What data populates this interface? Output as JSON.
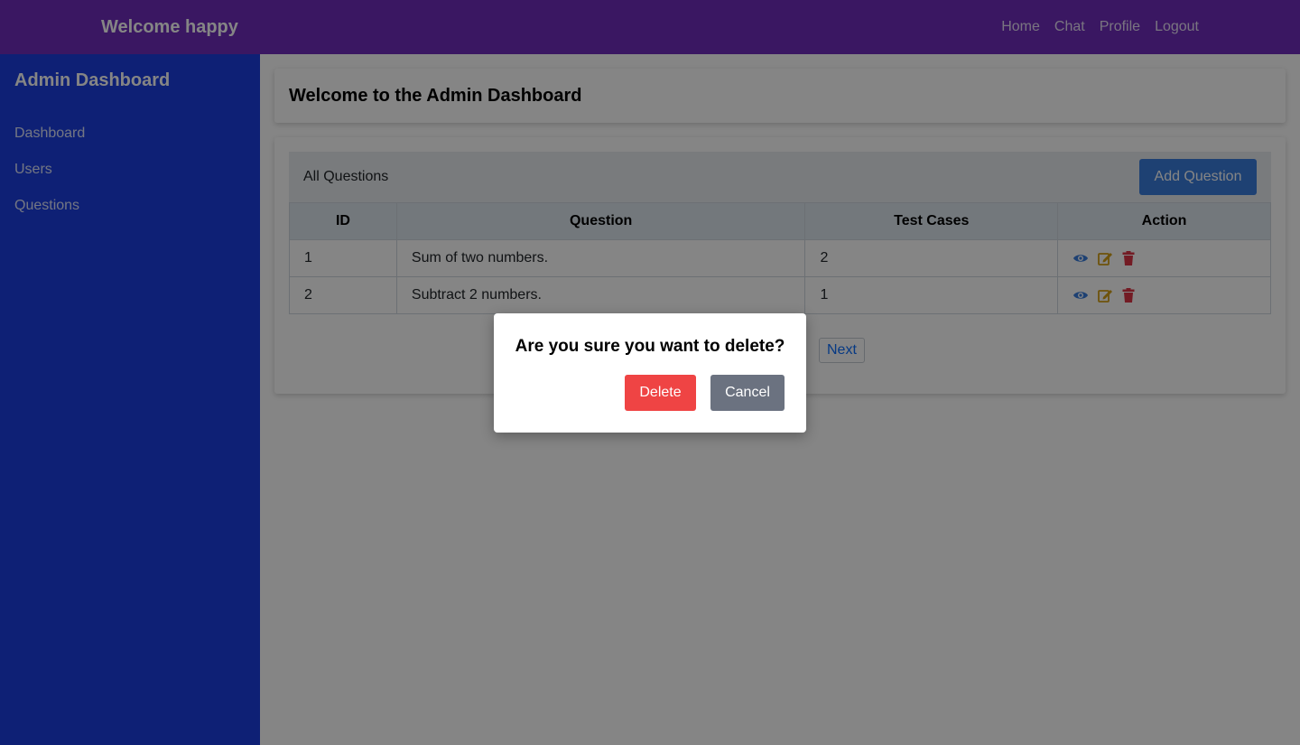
{
  "navbar": {
    "brand": "Welcome happy",
    "links": [
      "Home",
      "Chat",
      "Profile",
      "Logout"
    ],
    "color": "#6f2dbd"
  },
  "sidebar": {
    "title": "Admin Dashboard",
    "items": [
      "Dashboard",
      "Users",
      "Questions"
    ],
    "color": "#1b3ee0"
  },
  "main": {
    "heading": "Welcome to the Admin Dashboard",
    "questions": {
      "title": "All Questions",
      "add_button": "Add Question",
      "columns": [
        "ID",
        "Question",
        "Test Cases",
        "Action"
      ],
      "rows": [
        {
          "id": "1",
          "question": "Sum of two numbers.",
          "test_cases": "2",
          "actions": [
            "eye-icon",
            "edit-icon",
            "trash-icon"
          ]
        },
        {
          "id": "2",
          "question": "Subtract 2 numbers.",
          "test_cases": "1",
          "actions": [
            "eye-icon",
            "edit-icon",
            "trash-icon"
          ]
        }
      ],
      "pagination": {
        "next_label": "Next"
      }
    }
  },
  "modal": {
    "message": "Are you sure you want to delete?",
    "delete_label": "Delete",
    "cancel_label": "Cancel",
    "delete_color": "#ef4444",
    "cancel_color": "#6b7280"
  }
}
